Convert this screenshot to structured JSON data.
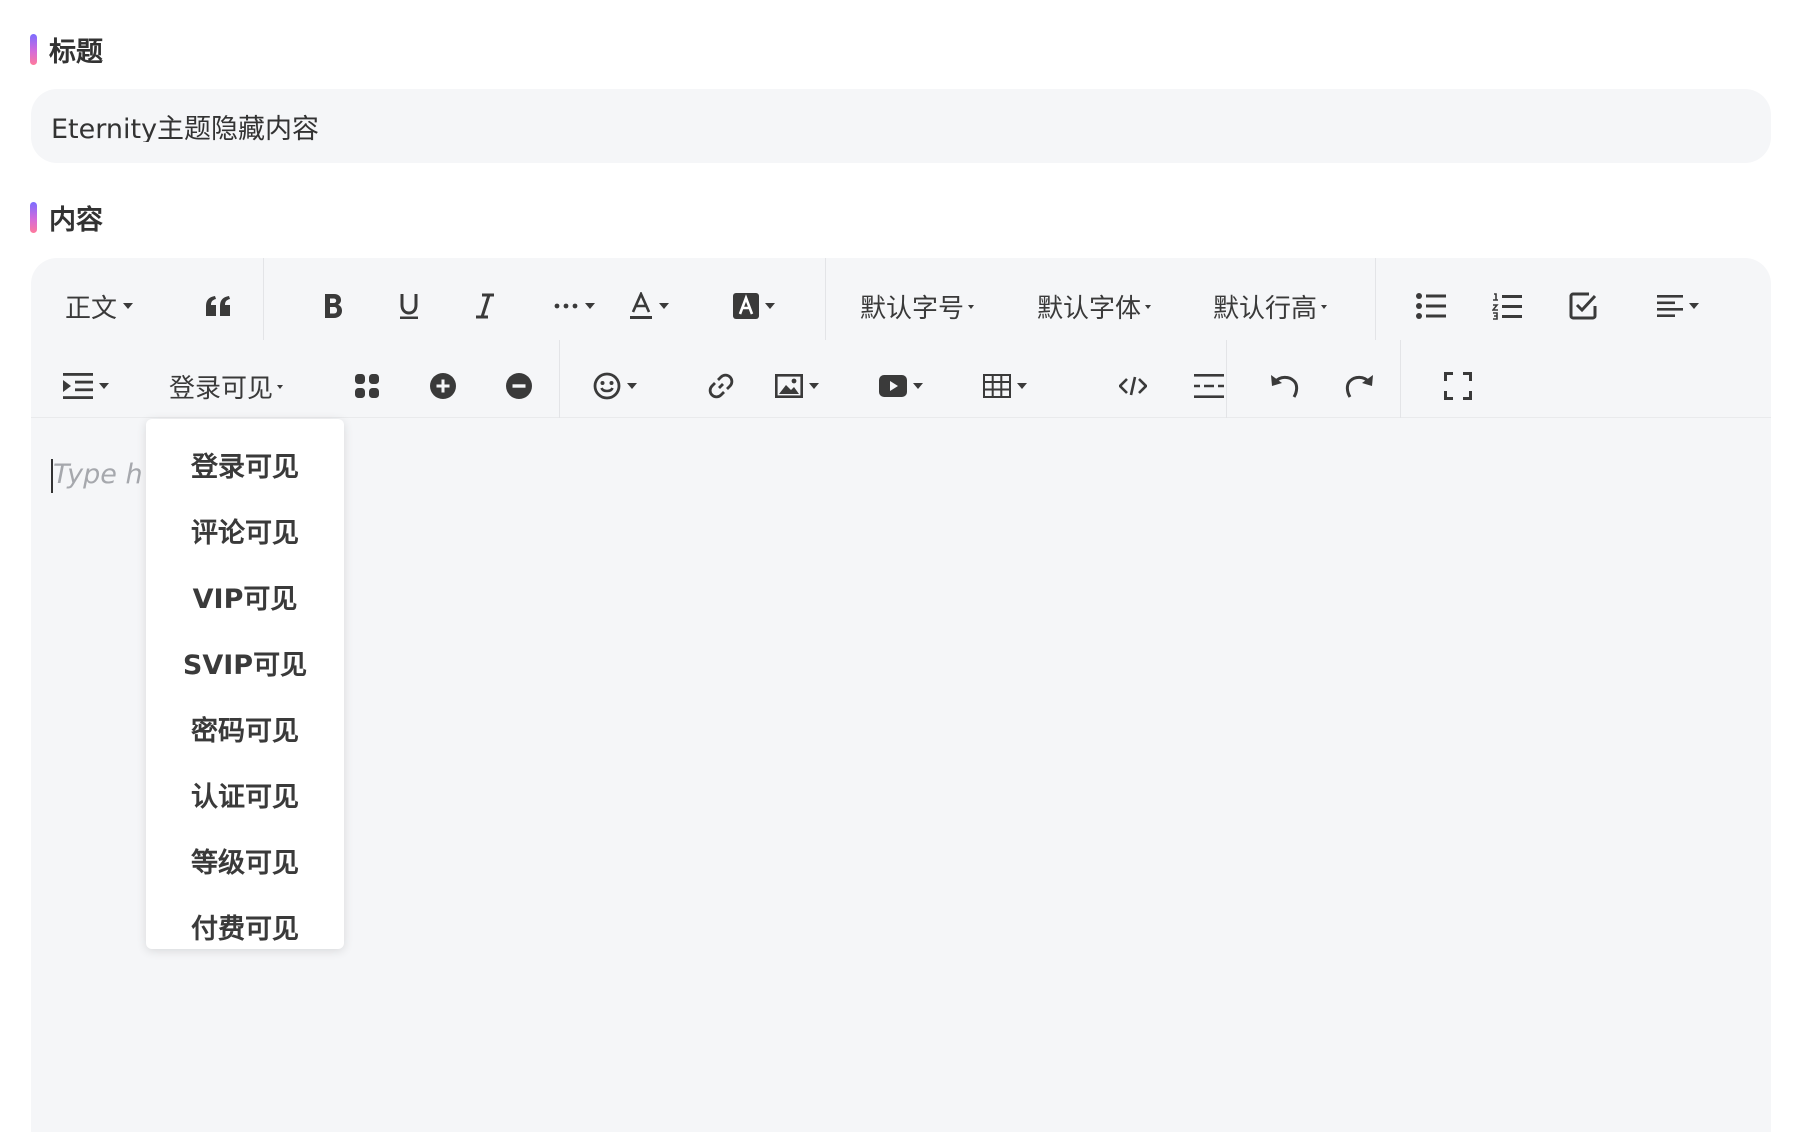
{
  "title_section": {
    "label": "标题",
    "input_value": "Eternity主题隐藏内容"
  },
  "content_section": {
    "label": "内容"
  },
  "toolbar": {
    "paragraph": "正文",
    "font_size": "默认字号",
    "font_family": "默认字体",
    "line_height": "默认行高",
    "hide_content": "登录可见"
  },
  "editor": {
    "placeholder": "Type h"
  },
  "dropdown": {
    "options": [
      "登录可见",
      "评论可见",
      "VIP可见",
      "SVIP可见",
      "密码可见",
      "认证可见",
      "等级可见",
      "付费可见"
    ]
  }
}
